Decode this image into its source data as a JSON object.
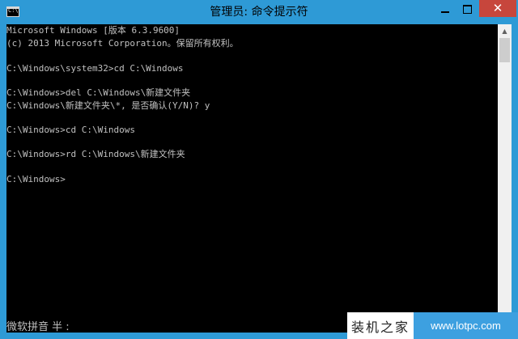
{
  "window": {
    "title": "管理员: 命令提示符",
    "app_icon_text": "C:\\",
    "close_symbol": "✕"
  },
  "console": {
    "lines": [
      "Microsoft Windows [版本 6.3.9600]",
      "(c) 2013 Microsoft Corporation。保留所有权利。",
      "",
      "C:\\Windows\\system32>cd C:\\Windows",
      "",
      "C:\\Windows>del C:\\Windows\\新建文件夹",
      "C:\\Windows\\新建文件夹\\*, 是否确认(Y/N)? y",
      "",
      "C:\\Windows>cd C:\\Windows",
      "",
      "C:\\Windows>rd C:\\Windows\\新建文件夹",
      "",
      "C:\\Windows>"
    ],
    "ime_status": "微软拼音 半 :"
  },
  "scrollbar": {
    "up_arrow": "▲",
    "down_arrow": "▼"
  },
  "watermark": {
    "site_name": "装机之家",
    "url": "www.lotpc.com"
  },
  "colors": {
    "titlebar": "#2e9ad6",
    "console_bg": "#000000",
    "console_text": "#c0c0c0",
    "close_button": "#c7463c"
  }
}
